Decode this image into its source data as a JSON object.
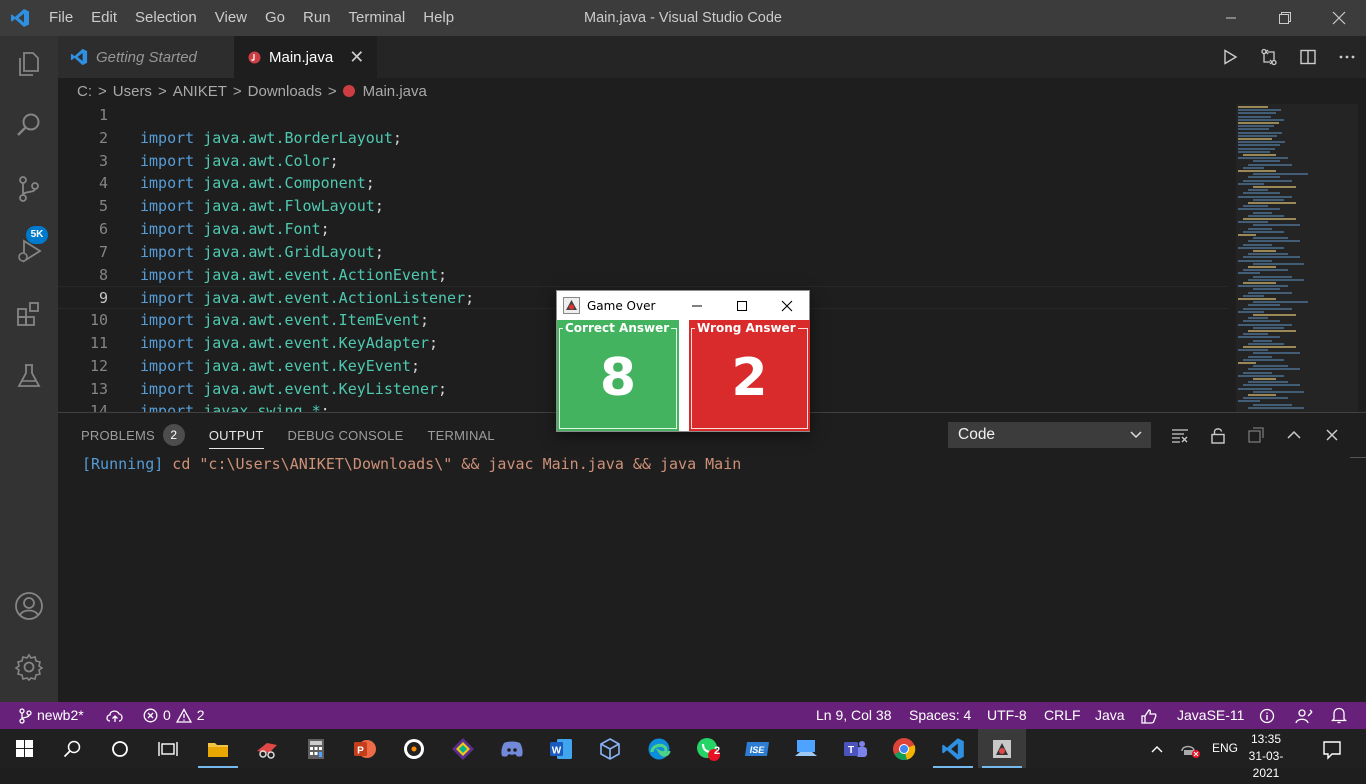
{
  "titlebar": {
    "menu": [
      "File",
      "Edit",
      "Selection",
      "View",
      "Go",
      "Run",
      "Terminal",
      "Help"
    ],
    "title": "Main.java - Visual Studio Code"
  },
  "activity": {
    "items": [
      "explorer-icon",
      "search-icon",
      "source-control-icon",
      "run-debug-icon",
      "extensions-icon",
      "testing-icon"
    ],
    "source_control_badge": "5K",
    "bottom": [
      "account-icon",
      "settings-gear-icon"
    ]
  },
  "tabs": [
    {
      "label": "Getting Started",
      "active": false
    },
    {
      "label": "Main.java",
      "active": true,
      "close": "✕"
    }
  ],
  "breadcrumb": [
    "C:",
    "Users",
    "ANIKET",
    "Downloads",
    "Main.java"
  ],
  "breadcrumb_sep": ">",
  "editor": {
    "active_line": 9,
    "lines": [
      {
        "n": "1",
        "kw": "",
        "pkg": "",
        "end": ""
      },
      {
        "n": "2",
        "kw": "import",
        "pkg": "java.awt.BorderLayout",
        "end": ";"
      },
      {
        "n": "3",
        "kw": "import",
        "pkg": "java.awt.Color",
        "end": ";"
      },
      {
        "n": "4",
        "kw": "import",
        "pkg": "java.awt.Component",
        "end": ";"
      },
      {
        "n": "5",
        "kw": "import",
        "pkg": "java.awt.FlowLayout",
        "end": ";"
      },
      {
        "n": "6",
        "kw": "import",
        "pkg": "java.awt.Font",
        "end": ";"
      },
      {
        "n": "7",
        "kw": "import",
        "pkg": "java.awt.GridLayout",
        "end": ";"
      },
      {
        "n": "8",
        "kw": "import",
        "pkg": "java.awt.event.ActionEvent",
        "end": ";"
      },
      {
        "n": "9",
        "kw": "import",
        "pkg": "java.awt.event.ActionListener",
        "end": ";"
      },
      {
        "n": "10",
        "kw": "import",
        "pkg": "java.awt.event.ItemEvent",
        "end": ";"
      },
      {
        "n": "11",
        "kw": "import",
        "pkg": "java.awt.event.KeyAdapter",
        "end": ";"
      },
      {
        "n": "12",
        "kw": "import",
        "pkg": "java.awt.event.KeyEvent",
        "end": ";"
      },
      {
        "n": "13",
        "kw": "import",
        "pkg": "java.awt.event.KeyListener",
        "end": ";"
      },
      {
        "n": "14",
        "kw": "import",
        "pkg": "javax.swing.*",
        "end": ";"
      }
    ]
  },
  "panel": {
    "tabs": [
      {
        "label": "PROBLEMS",
        "badge": "2",
        "active": false
      },
      {
        "label": "OUTPUT",
        "active": true
      },
      {
        "label": "DEBUG CONSOLE",
        "active": false
      },
      {
        "label": "TERMINAL",
        "active": false
      }
    ],
    "select_value": "Code",
    "output_running": "[Running]",
    "output_command": " cd \"c:\\Users\\ANIKET\\Downloads\\\" && javac Main.java && java Main"
  },
  "status": {
    "branch": "newb2*",
    "errors": "0",
    "warnings": "2",
    "position": "Ln 9, Col 38",
    "spaces": "Spaces: 4",
    "encoding": "UTF-8",
    "eol": "CRLF",
    "language": "Java",
    "runtime": "JavaSE-11"
  },
  "taskbar": {
    "apps": [
      "windows-start-icon",
      "search-icon",
      "cortana-icon",
      "task-view-icon",
      "file-explorer-icon",
      "snipping-icon",
      "calculator-icon",
      "powerpoint-icon",
      "media-icon",
      "app-icon",
      "discord-icon",
      "word-icon",
      "virtualbox-icon",
      "edge-icon",
      "whatsapp-icon",
      "pen-app-icon",
      "remote-icon",
      "teams-icon",
      "chrome-icon",
      "vscode-icon",
      "java-app-icon"
    ],
    "whatsapp_badge": "2",
    "lang": "ENG",
    "time": "13:35",
    "date": "31-03-2021"
  },
  "game_window": {
    "title": "Game Over",
    "correct_label": "Correct Answer",
    "correct_value": "8",
    "wrong_label": "Wrong Answer",
    "wrong_value": "2"
  },
  "colors": {
    "status_bar": "#68217a",
    "correct": "#44b360",
    "wrong": "#d92b2b",
    "keyword": "#569cd6",
    "package": "#4ec9b0"
  }
}
